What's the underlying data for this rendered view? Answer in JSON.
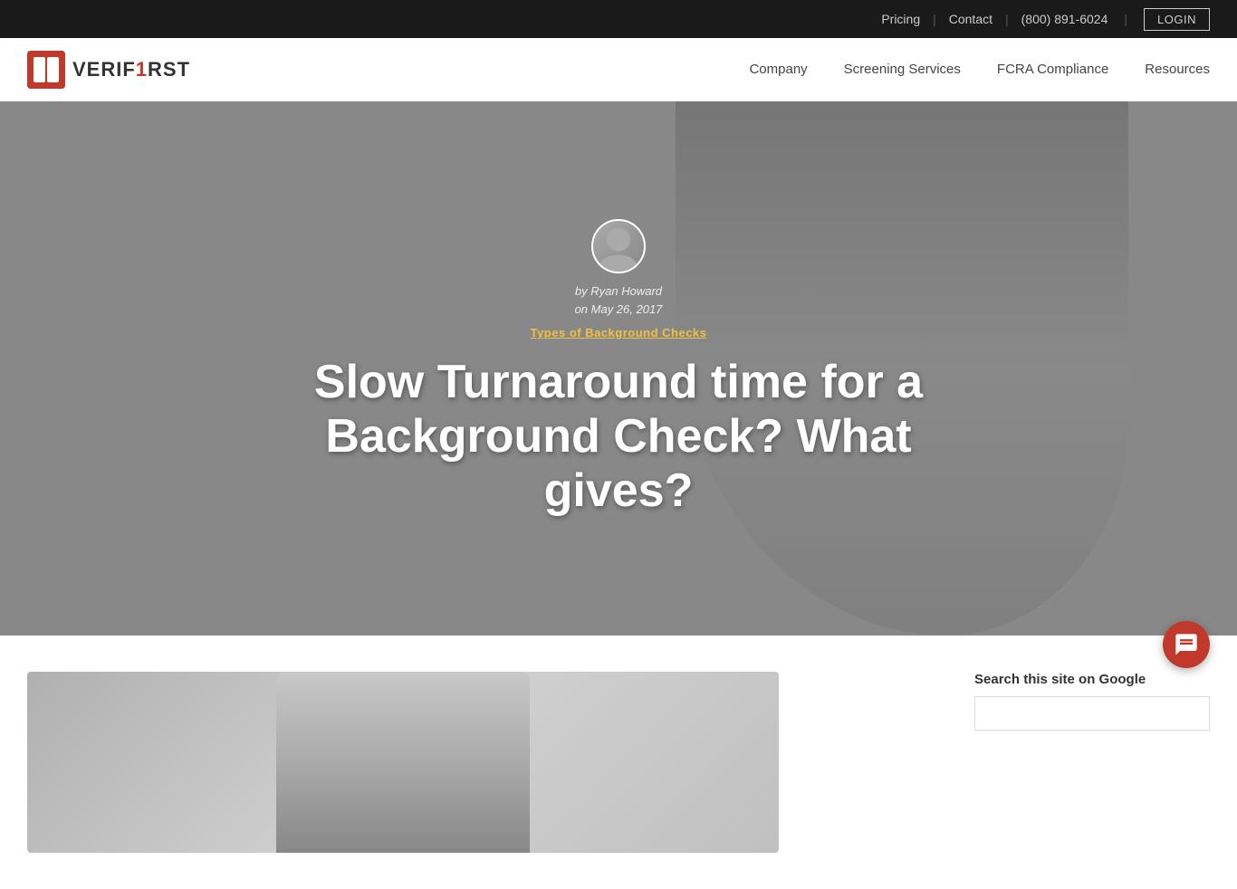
{
  "topbar": {
    "pricing_label": "Pricing",
    "contact_label": "Contact",
    "phone": "(800) 891-6024",
    "login_label": "LOGIN"
  },
  "nav": {
    "logo_text_part1": "VERIF",
    "logo_text_part2": "1",
    "logo_text_part3": "RST",
    "items": [
      {
        "label": "Company"
      },
      {
        "label": "Screening Services"
      },
      {
        "label": "FCRA Compliance"
      },
      {
        "label": "Resources"
      }
    ]
  },
  "hero": {
    "author_name": "by Ryan Howard",
    "author_date": "on May 26, 2017",
    "category": "Types of Background Checks",
    "title": "Slow Turnaround time for a Background Check? What gives?"
  },
  "sidebar": {
    "search_label": "Search this site on Google",
    "search_placeholder": ""
  },
  "chat": {
    "label": "Chat"
  }
}
